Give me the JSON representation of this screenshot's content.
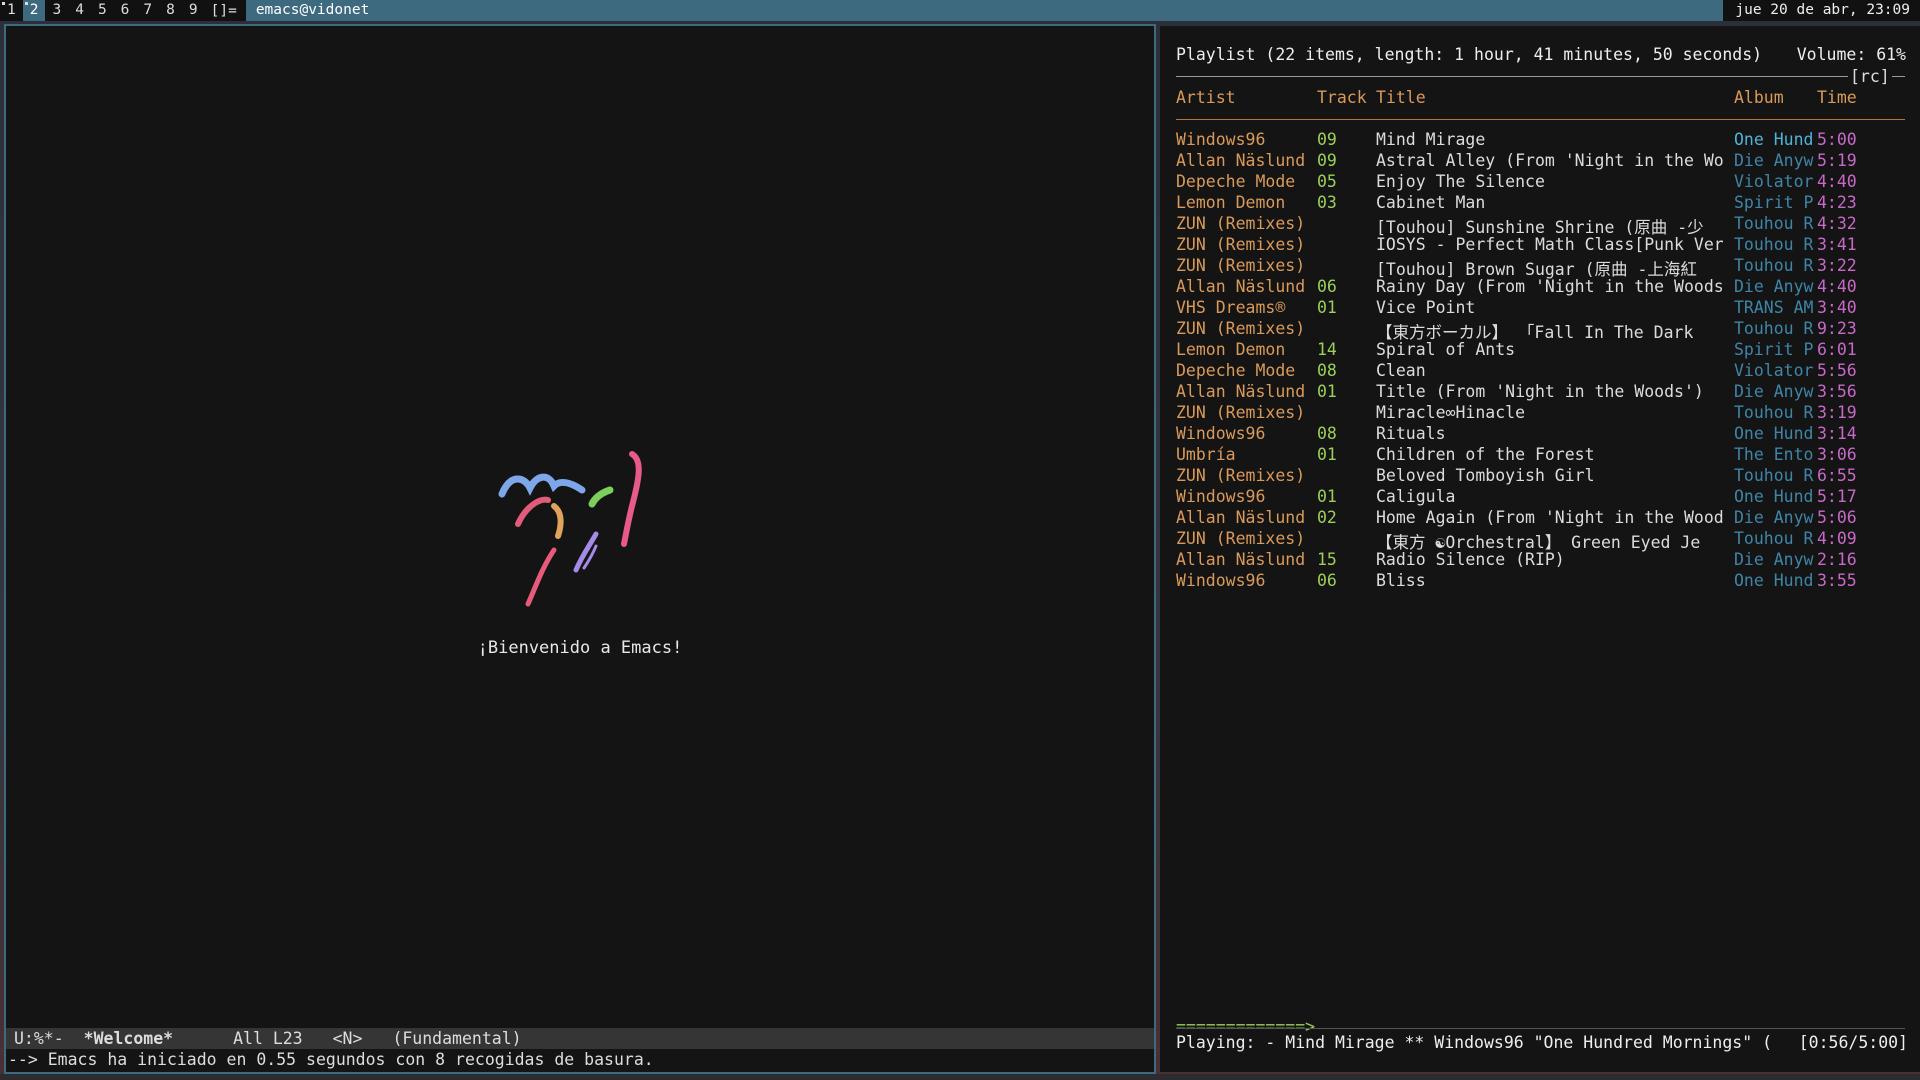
{
  "topbar": {
    "tags": [
      "1",
      "2",
      "3",
      "4",
      "5",
      "6",
      "7",
      "8",
      "9"
    ],
    "selected_tag": "2",
    "layout_symbol": "[]=",
    "window_title": "emacs@vidonet",
    "clock": "jue 20 de abr, 23:09"
  },
  "emacs": {
    "welcome": "¡Bienvenido a Emacs!",
    "modeline": {
      "state": "U:%*-",
      "buffer": "*Welcome*",
      "position": "All L23",
      "evil_state": "<N>",
      "mode": "(Fundamental)"
    },
    "echo": "--> Emacs ha iniciado en 0.55 segundos con 8 recogidas de basura."
  },
  "ncmpcpp": {
    "header": "Playlist (22 items, length: 1 hour, 41 minutes, 50 seconds)",
    "volume": "Volume: 61%",
    "flags": "[rc]",
    "columns": {
      "artist": "Artist",
      "track": "Track",
      "title": "Title",
      "album": "Album",
      "time": "Time"
    },
    "rows": [
      {
        "artist": "Windows96",
        "track": "09",
        "title": "Mind Mirage",
        "album": "One Hund",
        "time": "5:00"
      },
      {
        "artist": "Allan Näslund",
        "track": "09",
        "title": "Astral Alley (From 'Night in the Wo",
        "album": "Die Anyw",
        "time": "5:19"
      },
      {
        "artist": "Depeche Mode",
        "track": "05",
        "title": "Enjoy The Silence",
        "album": "Violator",
        "time": "4:40"
      },
      {
        "artist": "Lemon Demon",
        "track": "03",
        "title": "Cabinet Man",
        "album": "Spirit P",
        "time": "4:23"
      },
      {
        "artist": "ZUN (Remixes)",
        "track": "",
        "title": "[Touhou] Sunshine Shrine (原曲 -少",
        "album": "Touhou R",
        "time": "4:32"
      },
      {
        "artist": "ZUN (Remixes)",
        "track": "",
        "title": "IOSYS - Perfect Math Class[Punk Ver",
        "album": "Touhou R",
        "time": "3:41"
      },
      {
        "artist": "ZUN (Remixes)",
        "track": "",
        "title": "[Touhou] Brown Sugar (原曲 -上海紅",
        "album": "Touhou R",
        "time": "3:22"
      },
      {
        "artist": "Allan Näslund",
        "track": "06",
        "title": "Rainy Day (From 'Night in the Woods",
        "album": "Die Anyw",
        "time": "4:40"
      },
      {
        "artist": "VHS Dreams®",
        "track": "01",
        "title": "Vice Point",
        "album": "TRANS AM",
        "time": "3:40"
      },
      {
        "artist": "ZUN (Remixes)",
        "track": "",
        "title": "【東方ボーカル】 「Fall In The Dark",
        "album": "Touhou R",
        "time": "9:23"
      },
      {
        "artist": "Lemon Demon",
        "track": "14",
        "title": "Spiral of Ants",
        "album": "Spirit P",
        "time": "6:01"
      },
      {
        "artist": "Depeche Mode",
        "track": "08",
        "title": "Clean",
        "album": "Violator",
        "time": "5:56"
      },
      {
        "artist": "Allan Näslund",
        "track": "01",
        "title": "Title (From 'Night in the Woods')",
        "album": "Die Anyw",
        "time": "3:56"
      },
      {
        "artist": "ZUN (Remixes)",
        "track": "",
        "title": "Miracle∞Hinacle",
        "album": "Touhou R",
        "time": "3:19"
      },
      {
        "artist": "Windows96",
        "track": "08",
        "title": "Rituals",
        "album": "One Hund",
        "time": "3:14"
      },
      {
        "artist": "Umbría",
        "track": "01",
        "title": "Children of the Forest",
        "album": "The Ento",
        "time": "3:06"
      },
      {
        "artist": "ZUN (Remixes)",
        "track": "",
        "title": "Beloved Tomboyish Girl",
        "album": "Touhou R",
        "time": "6:55"
      },
      {
        "artist": "Windows96",
        "track": "01",
        "title": "Caligula",
        "album": "One Hund",
        "time": "5:17"
      },
      {
        "artist": "Allan Näslund",
        "track": "02",
        "title": "Home Again (From 'Night in the Wood",
        "album": "Die Anyw",
        "time": "5:06"
      },
      {
        "artist": "ZUN (Remixes)",
        "track": "",
        "title": "【東方 ☯Orchestral】 Green Eyed Je",
        "album": "Touhou R",
        "time": "4:09"
      },
      {
        "artist": "Allan Näslund",
        "track": "15",
        "title": "Radio Silence (RIP)",
        "album": "Die Anyw",
        "time": "2:16"
      },
      {
        "artist": "Windows96",
        "track": "06",
        "title": "Bliss",
        "album": "One Hund",
        "time": "3:55"
      }
    ],
    "progress_bar": "=============>",
    "status": "Playing: - Mind Mirage ** Windows96 \"One Hundred Mornings\" (",
    "elapsed": "[0:56/5:00]"
  }
}
